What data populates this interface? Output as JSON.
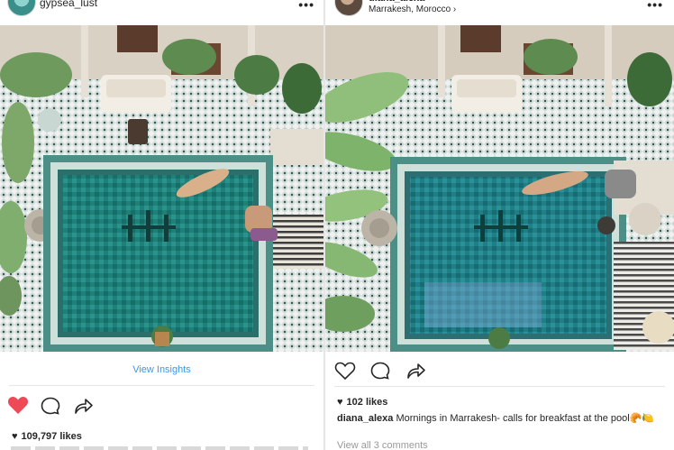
{
  "left_post": {
    "username": "gypsea_lust",
    "more_icon": "more-horizontal-icon",
    "view_insights": "View Insights",
    "likes": "109,797 likes",
    "liked": true,
    "icons": [
      "heart-filled-icon",
      "comment-icon",
      "share-icon"
    ],
    "colors": {
      "liked_heart": "#ed4956",
      "link": "#3897f0"
    }
  },
  "right_post": {
    "username": "diana_alexa",
    "location": "Marrakesh, Morocco",
    "more_icon": "more-horizontal-icon",
    "likes": "102 likes",
    "caption_user": "diana_alexa",
    "caption_text": "Mornings in Marrakesh- calls for breakfast at the pool",
    "caption_emoji": "🥐🍋",
    "comments_link": "View all 3 comments",
    "icons": [
      "heart-outline-icon",
      "comment-icon",
      "share-icon"
    ]
  }
}
